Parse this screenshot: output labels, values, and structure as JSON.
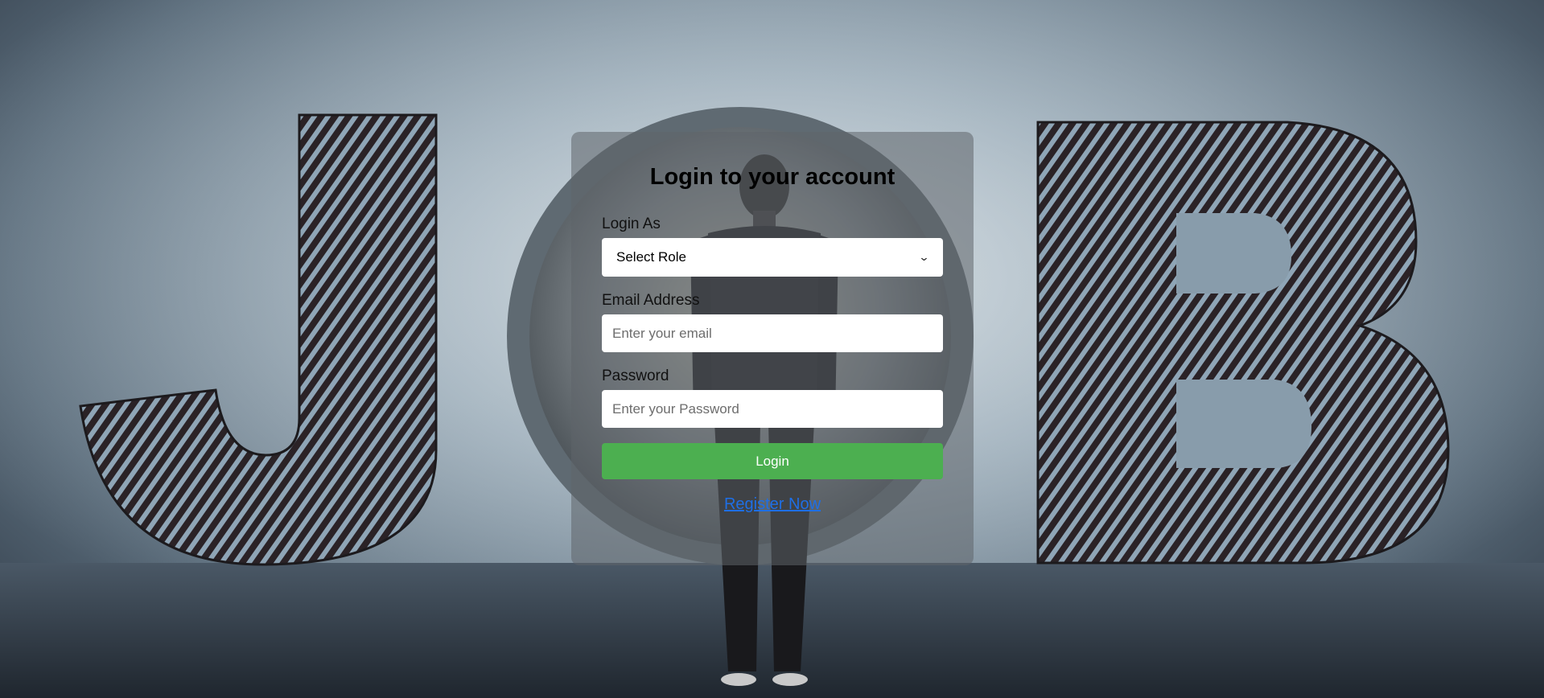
{
  "login_card": {
    "title": "Login to your account",
    "role_label": "Login As",
    "role_select_value": "Select Role",
    "email_label": "Email Address",
    "email_placeholder": "Enter your email",
    "password_label": "Password",
    "password_placeholder": "Enter your Password",
    "login_button": "Login",
    "register_link": "Register Now"
  },
  "background": {
    "letters": [
      "J",
      "O",
      "B"
    ]
  },
  "colors": {
    "button": "#4caf50",
    "link": "#1e6fe6",
    "card_overlay": "rgba(95,100,106,0.55)"
  },
  "icons": {
    "select_arrow": "chevron-down-icon"
  }
}
